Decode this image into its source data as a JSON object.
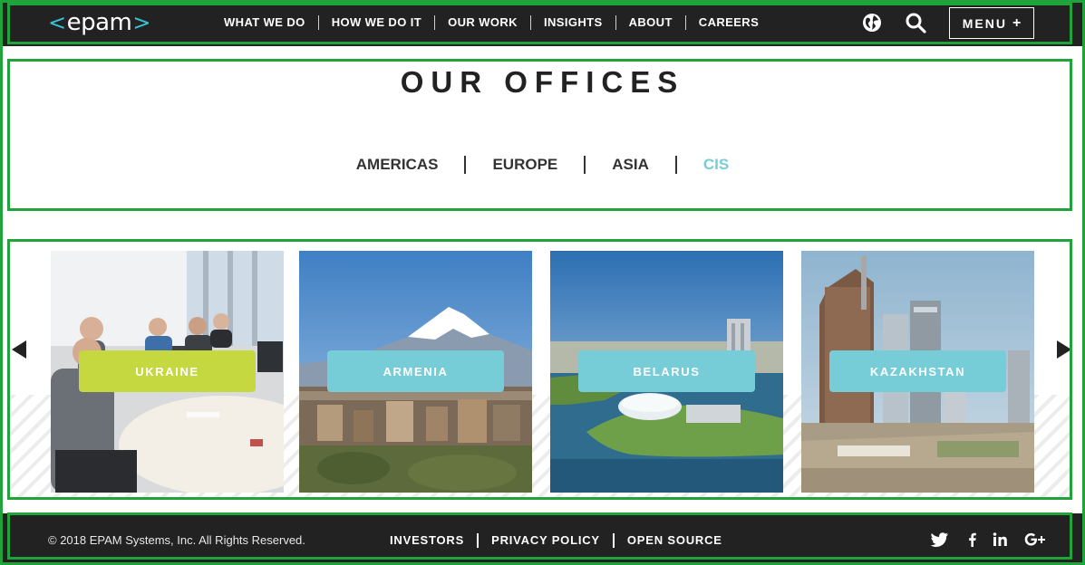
{
  "header": {
    "logo_text": "epam",
    "logo_left": "<",
    "logo_right": ">",
    "nav": [
      "WHAT WE DO",
      "HOW WE DO IT",
      "OUR WORK",
      "INSIGHTS",
      "ABOUT",
      "CAREERS"
    ],
    "globe_icon": "globe-icon",
    "search_icon": "search-icon",
    "menu_label": "MENU",
    "menu_plus": "+"
  },
  "offices": {
    "title": "OUR OFFICES",
    "regions": [
      "AMERICAS",
      "EUROPE",
      "ASIA",
      "CIS"
    ],
    "active_region": "CIS"
  },
  "carousel": {
    "prev_icon": "arrow-left-icon",
    "next_icon": "arrow-right-icon",
    "cards": [
      {
        "label": "UKRAINE",
        "color": "#c5d83f"
      },
      {
        "label": "ARMENIA",
        "color": "#76cdd8"
      },
      {
        "label": "BELARUS",
        "color": "#76cdd8"
      },
      {
        "label": "KAZAKHSTAN",
        "color": "#76cdd8"
      }
    ]
  },
  "footer": {
    "copyright": "© 2018 EPAM Systems, Inc. All Rights Reserved.",
    "links": [
      "INVESTORS",
      "PRIVACY POLICY",
      "OPEN SOURCE"
    ],
    "social": [
      "twitter-icon",
      "facebook-icon",
      "linkedin-icon",
      "google-plus-icon"
    ]
  },
  "colors": {
    "dark": "#222222",
    "accent_blue": "#76cdd8",
    "accent_green": "#c5d83f",
    "frame_green": "#1fa33a",
    "logo_bracket": "#39c2d7"
  }
}
